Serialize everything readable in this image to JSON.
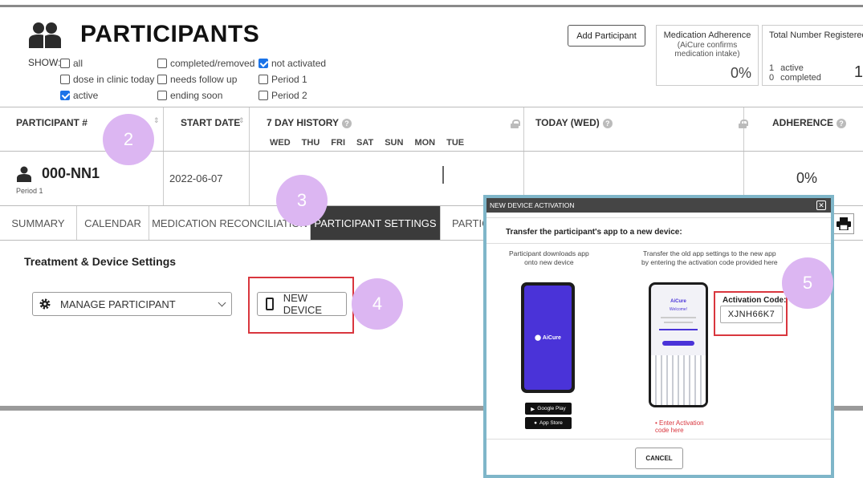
{
  "page": {
    "title": "PARTICIPANTS",
    "show_label": "SHOW:",
    "add_button": "Add Participant"
  },
  "filters": [
    {
      "label": "all",
      "checked": false
    },
    {
      "label": "dose in clinic today",
      "checked": false
    },
    {
      "label": "active",
      "checked": true
    },
    {
      "label": "completed/removed",
      "checked": false
    },
    {
      "label": "needs follow up",
      "checked": false
    },
    {
      "label": "ending soon",
      "checked": false
    },
    {
      "label": "not activated",
      "checked": true
    },
    {
      "label": "Period 1",
      "checked": false
    },
    {
      "label": "Period 2",
      "checked": false
    }
  ],
  "stats": {
    "med_title": "Medication Adherence",
    "med_sub1": "(AiCure confirms",
    "med_sub2": "medication intake)",
    "med_value": "0%",
    "total_title": "Total Number Registered",
    "active_count": "1",
    "active_label": "active",
    "completed_count": "0",
    "completed_label": "completed",
    "total_value": "1"
  },
  "table": {
    "headers": {
      "participant": "PARTICIPANT #",
      "start": "START DATE",
      "history": "7 DAY HISTORY",
      "today": "TODAY (WED)",
      "adherence": "ADHERENCE"
    },
    "days": [
      "WED",
      "THU",
      "FRI",
      "SAT",
      "SUN",
      "MON",
      "TUE"
    ],
    "row": {
      "id": "000-NN1",
      "period": "Period 1",
      "start_date": "2022-06-07",
      "adherence": "0%"
    }
  },
  "tabs": [
    "SUMMARY",
    "CALENDAR",
    "MEDICATION RECONCILIATION",
    "PARTICIPANT SETTINGS",
    "PARTIC"
  ],
  "settings": {
    "title": "Treatment & Device Settings",
    "manage": "MANAGE PARTICIPANT",
    "new_device": "NEW DEVICE"
  },
  "callouts": [
    "2",
    "3",
    "4",
    "5"
  ],
  "modal": {
    "title": "NEW DEVICE ACTIVATION",
    "close": "✕",
    "intro": "Transfer the participant's app to a new device:",
    "left_line1": "Participant downloads app",
    "left_line2": "onto new device",
    "right_line1": "Transfer the old app settings to the new app",
    "right_line2": "by entering the activation code provided here",
    "brand": "AiCure",
    "google_play": "Google Play",
    "app_store": "App Store",
    "phone2_brand": "AiCure",
    "phone2_welcome": "Welcome!",
    "activation_label": "Activation Code:",
    "activation_code": "XJNH66K7",
    "enter_line1": "• Enter Activation",
    "enter_line2": "code here",
    "cancel": "CANCEL"
  },
  "colors": {
    "accent_red": "#d9363e",
    "callout": "#dcb6f2",
    "modal_border": "#7fb6c9",
    "checkbox_blue": "#1a73e8",
    "active_tab": "#3b3b3b"
  }
}
